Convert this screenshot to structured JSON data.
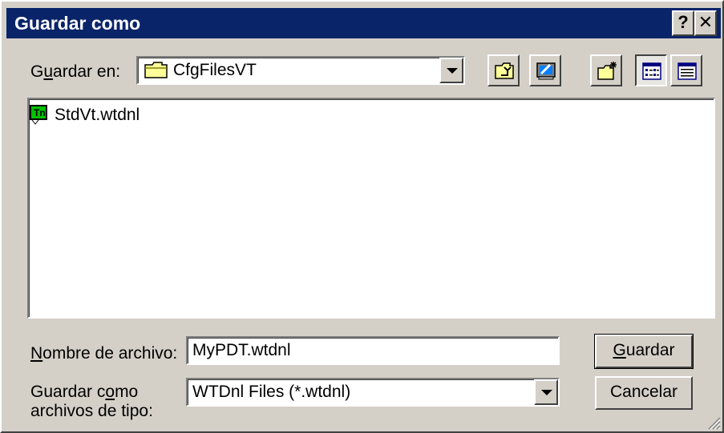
{
  "window": {
    "title": "Guardar como"
  },
  "title_buttons": {
    "help": "?",
    "close": "✕"
  },
  "save_in": {
    "label_pre": "G",
    "label_access": "u",
    "label_post": "ardar en:",
    "folder": "CfgFilesVT",
    "folder_icon": "folder-icon"
  },
  "toolbar": [
    {
      "name": "up-one-level",
      "icon": "up-folder-icon"
    },
    {
      "name": "desktop",
      "icon": "desktop-icon"
    },
    {
      "name": "new-folder",
      "icon": "new-folder-icon"
    },
    {
      "name": "list-view",
      "icon": "list-view-icon",
      "pressed": true
    },
    {
      "name": "details-view",
      "icon": "details-view-icon"
    }
  ],
  "files": [
    {
      "name": "StdVt.wtdnl",
      "icon": "wtdnl-file-icon"
    }
  ],
  "filename": {
    "label_access": "N",
    "label_post": "ombre de archivo:",
    "value": "MyPDT.wtdnl"
  },
  "filetype": {
    "label_line1_pre": "Guardar c",
    "label_line1_access": "o",
    "label_line1_post": "mo",
    "label_line2": "archivos de tipo:",
    "value": "WTDnl Files (*.wtdnl)"
  },
  "buttons": {
    "save_access": "G",
    "save_rest": "uardar",
    "cancel": "Cancelar"
  },
  "colors": {
    "title_bar": "#0a246a",
    "face": "#d4d0c8",
    "icon_green": "#00c000"
  }
}
